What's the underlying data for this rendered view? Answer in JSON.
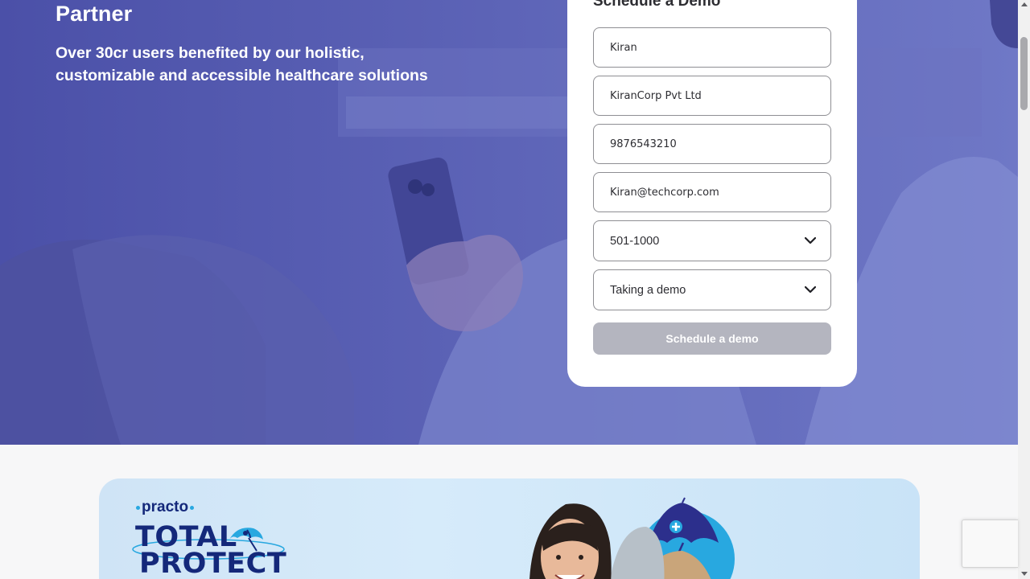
{
  "hero": {
    "title": "Partner",
    "subtitle": "Over 30cr users benefited by our holistic, customizable and accessible healthcare solutions"
  },
  "form": {
    "heading": "Schedule a Demo",
    "name_value": "Kiran",
    "company_value": "KiranCorp Pvt Ltd",
    "phone_value": "9876543210",
    "email_value": "Kiran@techcorp.com",
    "employees_selected": "501-1000",
    "interest_selected": "Taking a demo",
    "submit_label": "Schedule a demo"
  },
  "banner": {
    "logo_text": "practo",
    "product_line1": "TOTAL",
    "product_line2": "PROTECT"
  },
  "colors": {
    "hero_overlay": "#5358ae",
    "brand_navy": "#14287a",
    "brand_cyan": "#28a8e0",
    "disabled_button": "#b4b5bf"
  },
  "icons": {
    "select_chevron": "chevron-down-icon",
    "banner_umbrella": "umbrella-icon"
  }
}
